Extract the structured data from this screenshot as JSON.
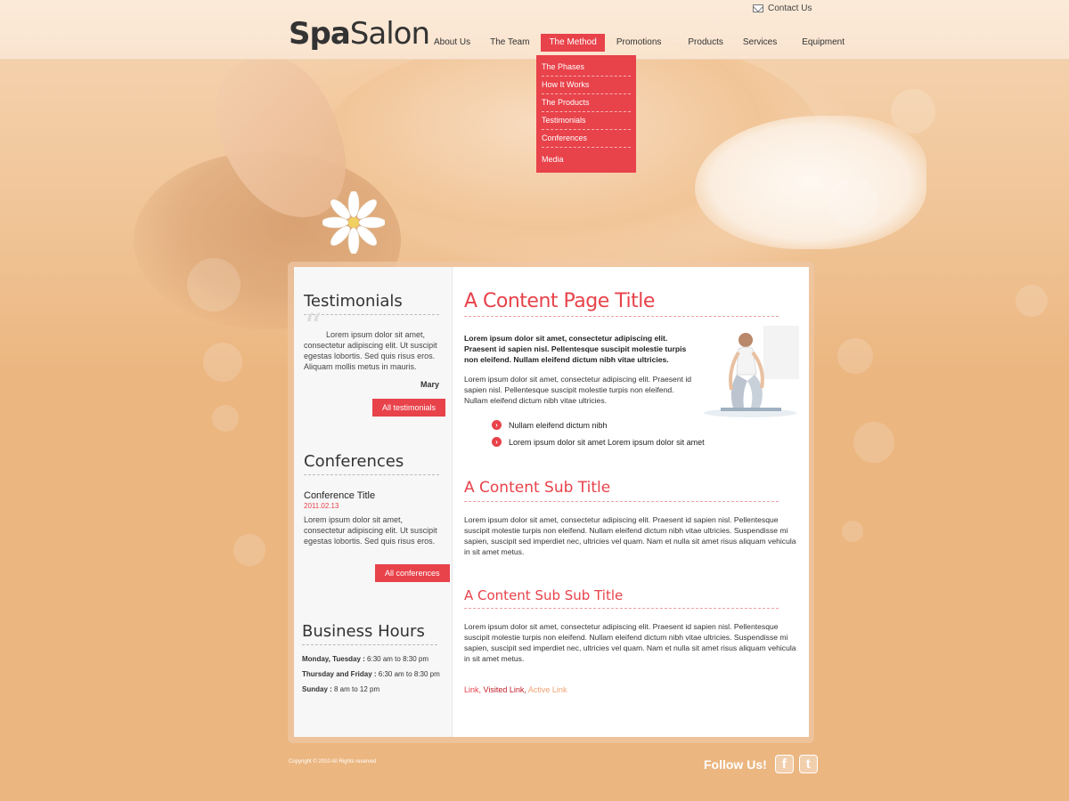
{
  "brand": {
    "logo_spa": "Spa",
    "logo_salon": "Salon"
  },
  "header": {
    "contact_label": "Contact Us"
  },
  "nav": {
    "items": [
      {
        "label": "About Us"
      },
      {
        "label": "The Team"
      },
      {
        "label": "The Method"
      },
      {
        "label": "Promotions"
      },
      {
        "label": "Products"
      },
      {
        "label": "Services"
      },
      {
        "label": "Equipment"
      }
    ],
    "active": "The Method",
    "dropdown": [
      {
        "label": "The Phases"
      },
      {
        "label": "How It Works"
      },
      {
        "label": "The Products"
      },
      {
        "label": "Testimonials"
      },
      {
        "label": "Conferences"
      },
      {
        "label": "Media"
      }
    ]
  },
  "sidebar": {
    "testimonials": {
      "title": "Testimonials",
      "quote": "Lorem ipsum dolor sit amet, consectetur adipiscing elit. Ut suscipit egestas lobortis. Sed quis risus eros. Aliquam mollis metus in mauris.",
      "author": "Mary",
      "button": "All testimonials"
    },
    "conferences": {
      "title": "Conferences",
      "item_title": "Conference Title",
      "item_date": "2011.02.13",
      "item_text": "Lorem ipsum dolor sit amet, consectetur adipiscing elit. Ut suscipit egestas lobortis. Sed quis risus eros.",
      "button": "All conferences"
    },
    "hours": {
      "title": "Business Hours",
      "lines": [
        {
          "days": "Monday, Tuesday :",
          "time": " 6:30 am to 8:30 pm"
        },
        {
          "days": "Thursday and Friday :",
          "time": " 6:30 am to 8:30 pm"
        },
        {
          "days": "Sunday :",
          "time": " 8 am to 12 pm"
        }
      ]
    }
  },
  "main": {
    "title": "A Content Page Title",
    "intro_bold": "Lorem ipsum dolor sit amet, consectetur adipiscing elit. Praesent id sapien nisl. Pellentesque suscipit molestie turpis non eleifend. Nullam eleifend dictum nibh vitae ultricies.",
    "intro": "Lorem ipsum dolor sit amet, consectetur adipiscing elit. Praesent id sapien nisl. Pellentesque suscipit molestie turpis non eleifend. Nullam eleifend dictum nibh vitae ultricies.",
    "bullets": [
      {
        "text": "Nullam eleifend dictum nibh"
      },
      {
        "text": "Lorem ipsum dolor sit amet Lorem ipsum dolor sit amet"
      }
    ],
    "sub_title": "A Content Sub Title",
    "sub_text": "Lorem ipsum dolor sit amet, consectetur adipiscing elit. Praesent id sapien nisl. Pellentesque suscipit molestie turpis non eleifend. Nullam eleifend dictum nibh vitae ultricies. Suspendisse mi sapien, suscipit sed imperdiet nec, ultricies vel quam. Nam et nulla sit amet risus aliquam vehicula in sit amet metus.",
    "subsub_title": "A Content Sub Sub Title",
    "subsub_text": "Lorem ipsum dolor sit amet, consectetur adipiscing elit. Praesent id sapien nisl. Pellentesque suscipit molestie turpis non eleifend. Nullam eleifend dictum nibh vitae ultricies. Suspendisse mi sapien, suscipit sed imperdiet nec, ultricies vel quam. Nam et nulla sit amet risus aliquam vehicula in sit amet metus.",
    "links": {
      "link": "Link",
      "visited": "Visited Link",
      "active": "Active Link"
    }
  },
  "footer": {
    "copyright": "Copyright © 2010 All Rights reserved",
    "follow": "Follow Us!",
    "facebook_glyph": "f",
    "twitter_glyph": "t"
  },
  "colors": {
    "accent": "#e8424a",
    "background": "#ebb680"
  },
  "icons": [
    "mail-icon",
    "quote-icon",
    "arrow-bullet-icon",
    "facebook-icon",
    "twitter-icon",
    "flower-image",
    "yoga-image"
  ]
}
